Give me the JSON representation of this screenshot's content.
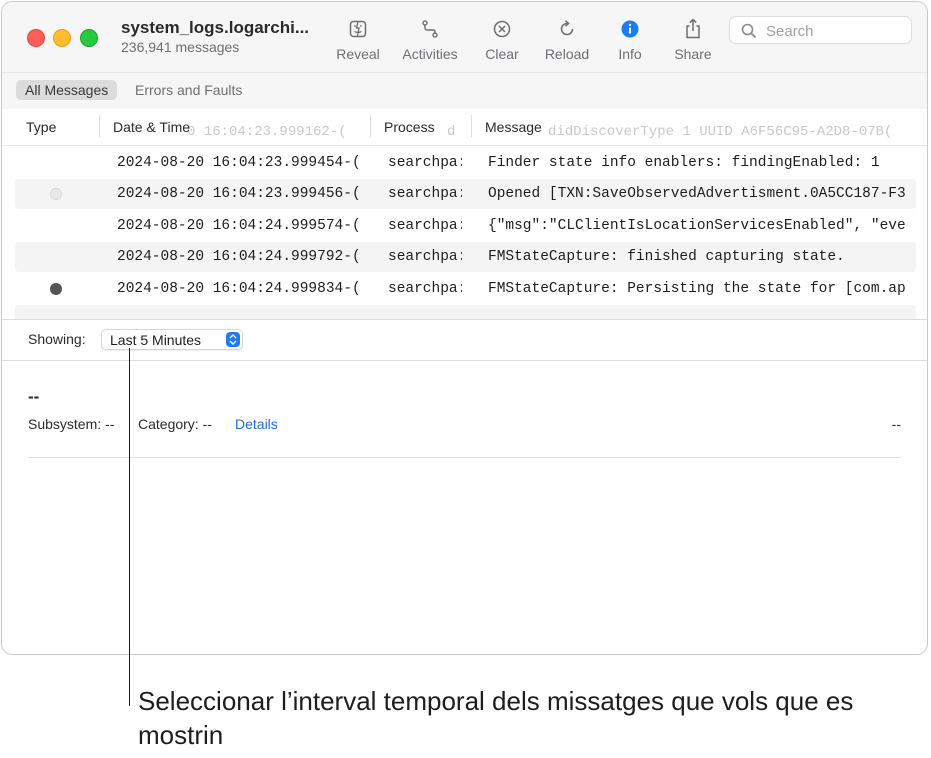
{
  "window": {
    "title": "system_logs.logarchi...",
    "subtitle": "236,941 messages"
  },
  "toolbar": {
    "reveal": {
      "label": "Reveal",
      "icon": "reveal-icon"
    },
    "activities": {
      "label": "Activities",
      "icon": "activities-icon"
    },
    "clear": {
      "label": "Clear",
      "icon": "clear-icon"
    },
    "reload": {
      "label": "Reload",
      "icon": "reload-icon"
    },
    "info": {
      "label": "Info",
      "icon": "info-icon"
    },
    "share": {
      "label": "Share",
      "icon": "share-icon"
    },
    "search": {
      "placeholder": "Search"
    }
  },
  "filters": {
    "all": "All Messages",
    "errors": "Errors and Faults"
  },
  "columns": {
    "type": "Type",
    "date": "Date & Time",
    "process": "Process",
    "message": "Message",
    "ghost_date": "0 16:04:23.999162-(",
    "ghost_proc": "d",
    "ghost_msg": "didDiscoverType 1 UUID A6F56C95-A2D8-07B("
  },
  "rows": [
    {
      "type": "",
      "date": "2024-08-20 16:04:23.999454-(",
      "process": "searchpa:",
      "message": "Finder state info enablers:   findingEnabled: 1"
    },
    {
      "type": "light",
      "date": "2024-08-20 16:04:23.999456-(",
      "process": "searchpa:",
      "message": "Opened [TXN:SaveObservedAdvertisment.0A5CC187-F3"
    },
    {
      "type": "",
      "date": "2024-08-20 16:04:24.999574-(",
      "process": "searchpa:",
      "message": "{\"msg\":\"CLClientIsLocationServicesEnabled\", \"eve"
    },
    {
      "type": "",
      "date": "2024-08-20 16:04:24.999792-(",
      "process": "searchpa:",
      "message": "FMStateCapture: finished capturing state."
    },
    {
      "type": "dark",
      "date": "2024-08-20 16:04:24.999834-(",
      "process": "searchpa:",
      "message": "FMStateCapture: Persisting the state for [com.ap"
    }
  ],
  "showing": {
    "label": "Showing:",
    "value": "Last 5 Minutes"
  },
  "detail": {
    "title": "--",
    "subsystem": "Subsystem: --",
    "category": "Category: --",
    "details_link": "Details",
    "right": "--"
  },
  "callout": {
    "text": "Seleccionar l’interval temporal dels missatges que vols que es mostrin"
  },
  "colors": {
    "accent": "#1d7bf5",
    "link": "#1a6fd6",
    "close": "#ff5f57",
    "minimize": "#febc2e",
    "zoom": "#28c840"
  }
}
